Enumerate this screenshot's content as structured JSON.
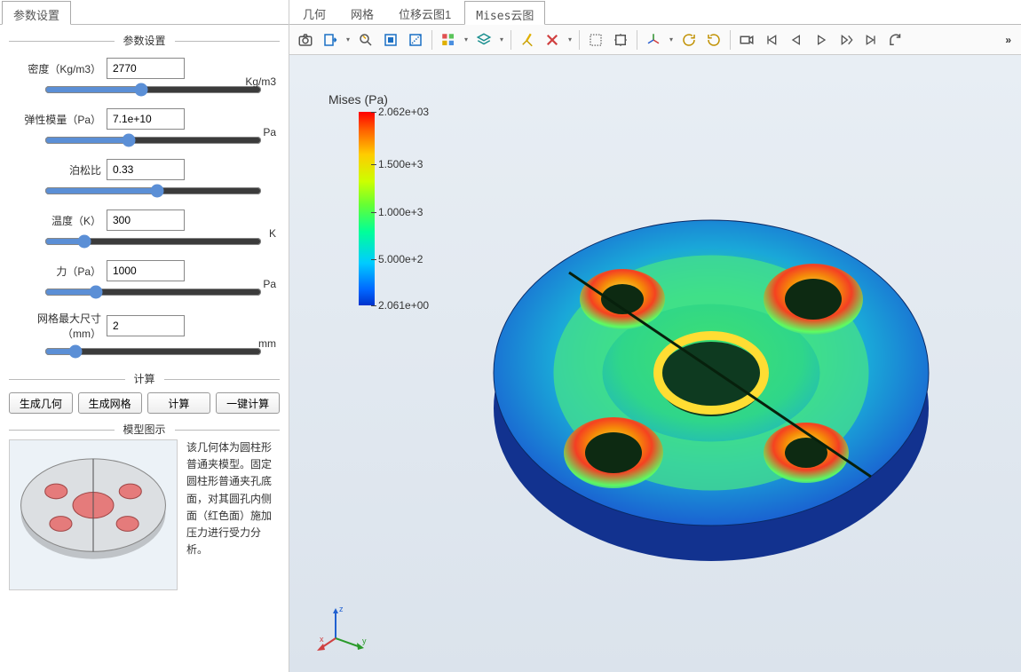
{
  "left": {
    "tab": "参数设置",
    "groups": {
      "params": "参数设置",
      "calc": "计算",
      "model": "模型图示"
    },
    "fields": {
      "density": {
        "label": "密度（Kg/m3）",
        "value": "2770",
        "unit": "Kg/m3"
      },
      "emod": {
        "label": "弹性模量（Pa）",
        "value": "7.1e+10",
        "unit": "Pa"
      },
      "poisson": {
        "label": "泊松比",
        "value": "0.33",
        "unit": ""
      },
      "temp": {
        "label": "温度（K）",
        "value": "300",
        "unit": "K"
      },
      "force": {
        "label": "力（Pa）",
        "value": "1000",
        "unit": "Pa"
      },
      "mesh": {
        "label": "网格最大尺寸（mm）",
        "value": "2",
        "unit": "mm"
      }
    },
    "buttons": {
      "gen_geom": "生成几何",
      "gen_mesh": "生成网格",
      "compute": "计算",
      "onekey": "一键计算"
    },
    "model_desc": "该几何体为圆柱形普通夹模型。固定圆柱形普通夹孔底面，对其圆孔内侧面（红色面）施加压力进行受力分析。"
  },
  "right": {
    "tabs": [
      "几何",
      "网格",
      "位移云图1",
      "Mises云图"
    ],
    "active_tab": 3,
    "toolbar_icons": [
      "camera-icon",
      "export-icon",
      "zoom-icon",
      "select-box-icon",
      "select-region-icon",
      "components-icon",
      "layers-icon",
      "clear-icon",
      "delete-icon",
      "crop-icon",
      "fit-icon",
      "axis-icon",
      "rotate-cw-icon",
      "rotate-ccw-icon",
      "rec-start-icon",
      "first-icon",
      "prev-icon",
      "play-icon",
      "next-icon",
      "last-icon",
      "loop-icon"
    ],
    "legend": {
      "title": "Mises (Pa)",
      "ticks": [
        {
          "label": "2.062e+03",
          "pos": 0
        },
        {
          "label": "1.500e+3",
          "pos": 27
        },
        {
          "label": "1.000e+3",
          "pos": 52
        },
        {
          "label": "5.000e+2",
          "pos": 76
        },
        {
          "label": "2.061e+00",
          "pos": 100
        }
      ]
    },
    "triad": {
      "x": "x",
      "y": "y",
      "z": "z"
    }
  },
  "chart_data": {
    "type": "heatmap",
    "title": "Mises (Pa)",
    "colorbar": {
      "min": 2.061,
      "max": 2062,
      "unit": "Pa",
      "colormap": "rainbow"
    },
    "ticks": [
      2.061,
      500,
      1000,
      1500,
      2062
    ]
  }
}
